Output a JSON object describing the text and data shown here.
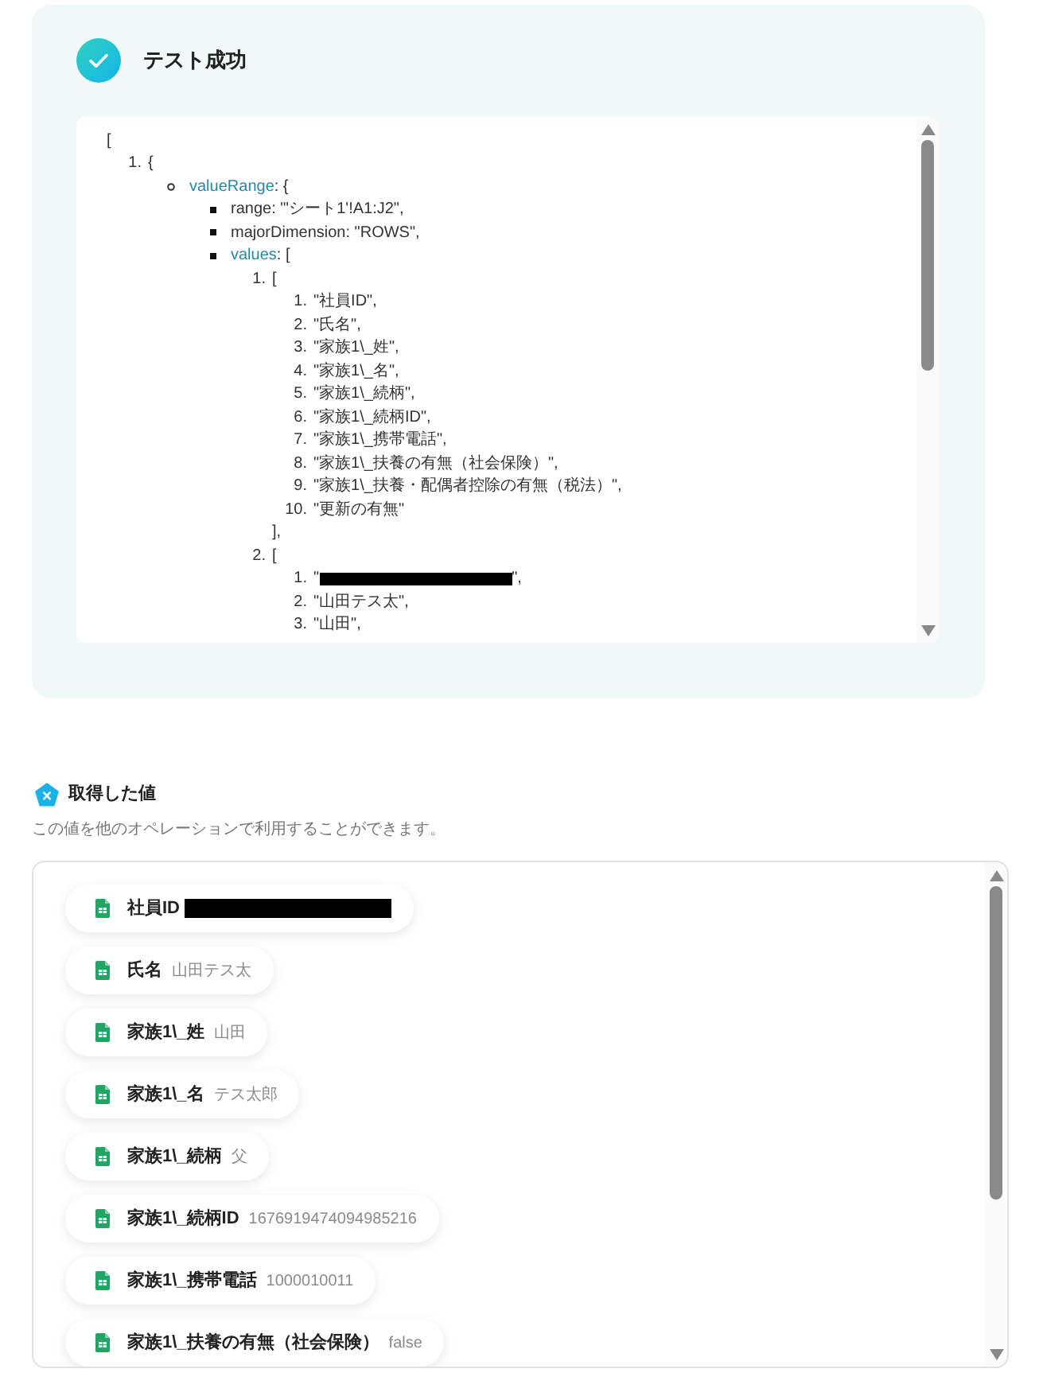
{
  "test_result": {
    "title": "テスト成功",
    "code_view": {
      "kind": "plain",
      "text": "[",
      "children": [
        {
          "kind": "number",
          "marker": "1.",
          "text": "{",
          "children": [
            {
              "kind": "circle",
              "key": "valueRange",
              "highlighted": true,
              "text": ": {",
              "children": [
                {
                  "kind": "square",
                  "key": "range",
                  "highlighted": false,
                  "text": ": \"'シート1'!A1:J2\","
                },
                {
                  "kind": "square",
                  "key": "majorDimension",
                  "highlighted": false,
                  "text": ": \"ROWS\","
                },
                {
                  "kind": "square",
                  "key": "values",
                  "highlighted": true,
                  "text": ": [",
                  "children": [
                    {
                      "kind": "number",
                      "marker": "1.",
                      "text": "[",
                      "close": "],",
                      "children": [
                        {
                          "kind": "number",
                          "marker": "1.",
                          "text": "\"社員ID\","
                        },
                        {
                          "kind": "number",
                          "marker": "2.",
                          "text": "\"氏名\","
                        },
                        {
                          "kind": "number",
                          "marker": "3.",
                          "text": "\"家族1\\_姓\","
                        },
                        {
                          "kind": "number",
                          "marker": "4.",
                          "text": "\"家族1\\_名\","
                        },
                        {
                          "kind": "number",
                          "marker": "5.",
                          "text": "\"家族1\\_続柄\","
                        },
                        {
                          "kind": "number",
                          "marker": "6.",
                          "text": "\"家族1\\_続柄ID\","
                        },
                        {
                          "kind": "number",
                          "marker": "7.",
                          "text": "\"家族1\\_携帯電話\","
                        },
                        {
                          "kind": "number",
                          "marker": "8.",
                          "text": "\"家族1\\_扶養の有無（社会保険）\","
                        },
                        {
                          "kind": "number",
                          "marker": "9.",
                          "text": "\"家族1\\_扶養・配偶者控除の有無（税法）\","
                        },
                        {
                          "kind": "number",
                          "marker": "10.",
                          "text": "\"更新の有無\""
                        }
                      ]
                    },
                    {
                      "kind": "number",
                      "marker": "2.",
                      "text": "[",
                      "children": [
                        {
                          "kind": "number",
                          "marker": "1.",
                          "text": "\"",
                          "redacted": true,
                          "text_after": "\","
                        },
                        {
                          "kind": "number",
                          "marker": "2.",
                          "text": "\"山田テス太\","
                        },
                        {
                          "kind": "number",
                          "marker": "3.",
                          "text": "\"山田\","
                        }
                      ]
                    }
                  ]
                }
              ]
            }
          ]
        }
      ]
    }
  },
  "values_section": {
    "title": "取得した値",
    "description": "この値を他のオペレーションで利用することができます。",
    "items": [
      {
        "label": "社員ID",
        "redacted": true
      },
      {
        "label": "氏名",
        "value": "山田テス太",
        "redacted": false
      },
      {
        "label": "家族1\\_姓",
        "value": "山田",
        "redacted": false
      },
      {
        "label": "家族1\\_名",
        "value": "テス太郎",
        "redacted": false
      },
      {
        "label": "家族1\\_続柄",
        "value": "父",
        "redacted": false
      },
      {
        "label": "家族1\\_続柄ID",
        "value": "1676919474094985216",
        "redacted": false
      },
      {
        "label": "家族1\\_携帯電話",
        "value": "1000010011",
        "redacted": false
      },
      {
        "label": "家族1\\_扶養の有無（社会保険）",
        "value": "false",
        "redacted": false
      }
    ]
  }
}
